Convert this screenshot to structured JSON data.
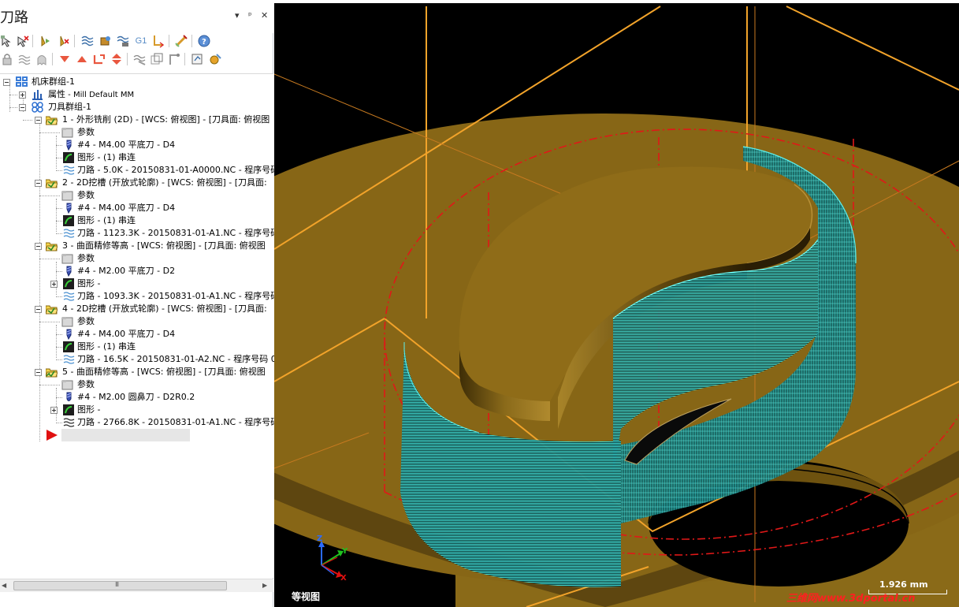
{
  "panel": {
    "title": "刀路",
    "controls": {
      "menu": "▾",
      "pin": "ᵖ",
      "close": "✕"
    }
  },
  "toolbar_row1": [
    "select-all-ops-icon",
    "select-failed-ops-icon",
    "regenerate-selected-icon",
    "regenerate-dirty-icon",
    "backplot-icon",
    "verify-icon",
    "simulate-icon",
    "post-g1-icon",
    "highfeed-icon",
    "delete-all-icon",
    "help-icon"
  ],
  "toolbar_row2": [
    "lock-icon",
    "toggle-display-icon",
    "ghost-icon",
    "move-down-icon",
    "move-up-icon",
    "insert-arrow-icon",
    "scroll-icon",
    "toolpath-only-icon",
    "show-icon",
    "tool-only-icon",
    "edit-icon",
    "misc-icon"
  ],
  "g1_label": "G1",
  "tree": {
    "machine_group": "机床群组-1",
    "properties": "属性",
    "properties_suffix": " - Mill Default MM",
    "toolgroup": "刀具群组-1",
    "ops": [
      {
        "title": "1 - 外形铣削 (2D) - [WCS: 俯视图] - [刀具面: 俯视图",
        "params": "参数",
        "tool": "#4 - M4.00 平底刀 - D4",
        "geometry": "图形 - (1) 串连",
        "toolpath": "刀路 - 5.0K - 20150831-01-A0000.NC - 程序号码",
        "geometry_collapsed": false
      },
      {
        "title": "2 - 2D挖槽 (开放式轮廓) - [WCS: 俯视图] - [刀具面:",
        "params": "参数",
        "tool": "#4 - M4.00 平底刀 - D4",
        "geometry": "图形 - (1) 串连",
        "toolpath": "刀路 - 1123.3K - 20150831-01-A1.NC - 程序号码",
        "geometry_collapsed": false
      },
      {
        "title": "3 - 曲面精修等高 - [WCS: 俯视图] - [刀具面: 俯视图",
        "params": "参数",
        "tool": "#4 - M2.00 平底刀 - D2",
        "geometry": "图形 -",
        "toolpath": "刀路 - 1093.3K - 20150831-01-A1.NC - 程序号码",
        "geometry_collapsed": true
      },
      {
        "title": "4 - 2D挖槽 (开放式轮廓) - [WCS: 俯视图] - [刀具面:",
        "params": "参数",
        "tool": "#4 - M4.00 平底刀 - D4",
        "geometry": "图形 - (1) 串连",
        "toolpath": "刀路 - 16.5K - 20150831-01-A2.NC - 程序号码 0",
        "geometry_collapsed": false
      },
      {
        "title": "5 - 曲面精修等高 - [WCS: 俯视图] - [刀具面: 俯视图",
        "params": "参数",
        "tool": "#4 - M2.00 圆鼻刀 - D2R0.2",
        "geometry": "图形 -",
        "toolpath": "刀路 - 2766.8K - 20150831-01-A1.NC - 程序号码",
        "geometry_collapsed": true
      }
    ]
  },
  "scrollbar": {
    "grip": "III"
  },
  "viewport": {
    "view_name": "等视图",
    "scale_label": "1.926 mm",
    "axis_labels": {
      "z": "Z",
      "y": "Y",
      "x": "X"
    },
    "watermark": "三维网www.3dportal.cn"
  },
  "colors": {
    "viewport_bg": "#000000",
    "part_gold": "#8b6a1a",
    "part_gold_light": "#9b7a26",
    "part_gold_dark": "#4a3608",
    "toolpath_cyan": "#3de0dd",
    "boundary_orange": "#f2a32a",
    "dashed_red": "#e01818",
    "arrow_red": "#e01010"
  }
}
